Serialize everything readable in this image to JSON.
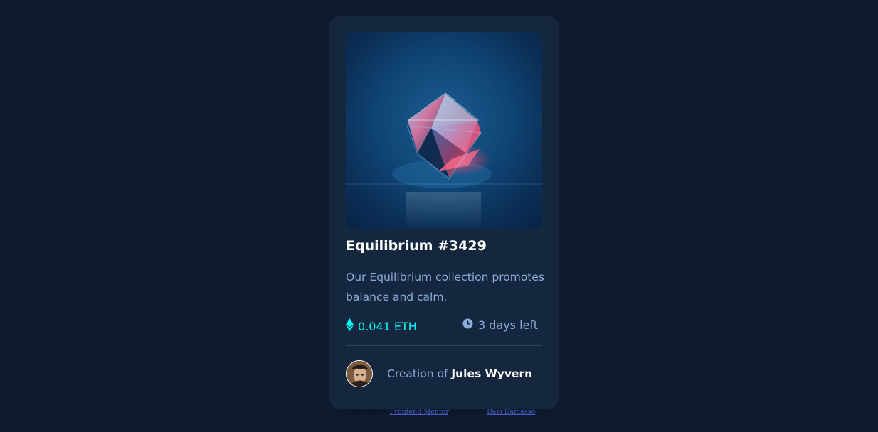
{
  "card": {
    "title": "Equilibrium #3429",
    "description": "Our Equilibrium collection promotes balance and calm.",
    "price": "0.041 ETH",
    "time_left": "3 days left",
    "creator_prefix": "Creation of ",
    "creator_name": "Jules Wyvern",
    "icons": {
      "price": "ethereum-icon",
      "time": "clock-icon",
      "image": "equilibrium-cube-image",
      "avatar": "avatar-image"
    }
  },
  "attribution": {
    "prefix": "Challenge by ",
    "frontend_mentor": "Frontend Mentor",
    "coded_by": ". Coded by ",
    "author": "Davi Damasso",
    "suffix": ""
  },
  "colors": {
    "page_bg": "#0d192c",
    "card_bg": "#15263f",
    "accent_cyan": "#00fff8",
    "soft_blue": "#8bacd9",
    "white": "#ffffff",
    "divider": "#2e405a"
  }
}
